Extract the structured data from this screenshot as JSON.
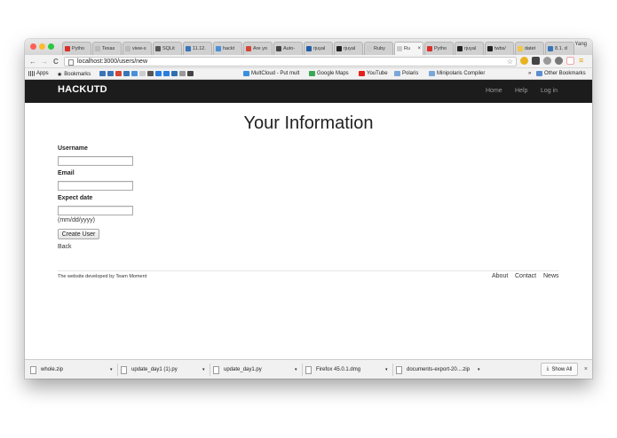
{
  "browser": {
    "profile_name": "Yang",
    "tabs": [
      {
        "label": "Pytho",
        "color": "#d9302b"
      },
      {
        "label": "Texas",
        "color": "#bbbbbb"
      },
      {
        "label": "view-s",
        "color": "#bbbbbb"
      },
      {
        "label": "SQLit",
        "color": "#555555"
      },
      {
        "label": "11.12.",
        "color": "#3a74b8"
      },
      {
        "label": "hackt",
        "color": "#4a90d9"
      },
      {
        "label": "Are yo",
        "color": "#d44638"
      },
      {
        "label": "Auto-",
        "color": "#444444"
      },
      {
        "label": "rjuyal",
        "color": "#1f5fa8"
      },
      {
        "label": "rjuyal",
        "color": "#222222"
      },
      {
        "label": "Ruby",
        "color": "#cccccc"
      },
      {
        "label": "Ru",
        "color": "#cccccc",
        "active": true
      },
      {
        "label": "Pytho",
        "color": "#d9302b"
      },
      {
        "label": "rjuyal",
        "color": "#222222"
      },
      {
        "label": "twbs/",
        "color": "#222222"
      },
      {
        "label": "datet",
        "color": "#f3c74a"
      },
      {
        "label": "8.1. d",
        "color": "#3a74b8"
      }
    ],
    "tab_close_glyph": "×",
    "url": "localhost:3000/users/new",
    "back_glyph": "←",
    "forward_glyph": "→",
    "reload_glyph": "C",
    "star_glyph": "☆",
    "menu_glyph": "≡",
    "bookmarks": {
      "apps_label": "Apps",
      "bookmarks_label": "Bookmarks",
      "items": [
        {
          "label": "MultCloud - Put mult",
          "color": "#3b8fe0"
        },
        {
          "label": "Google Maps",
          "color": "#3aa757"
        },
        {
          "label": "YouTube",
          "color": "#e62117"
        },
        {
          "label": "Polaris",
          "color": "#7aa7d9"
        },
        {
          "label": "Minipolaris Compiler",
          "color": "#7aa7d9"
        }
      ],
      "overflow_label": "»",
      "other_label": "Other Bookmarks"
    }
  },
  "site": {
    "brand": "HACKUTD",
    "nav": {
      "home": "Home",
      "help": "Help",
      "login": "Log in"
    }
  },
  "form": {
    "title": "Your Information",
    "username_label": "Username",
    "username_value": "",
    "email_label": "Email",
    "email_value": "",
    "expect_date_label": "Expect date",
    "expect_date_value": "",
    "date_hint": "(mm/dd/yyyy)",
    "submit_label": "Create User",
    "back_link": "Back"
  },
  "footer": {
    "credit_prefix": "The website developed by",
    "credit_author": "Team Moment",
    "links": {
      "about": "About",
      "contact": "Contact",
      "news": "News"
    }
  },
  "downloads": {
    "items": [
      {
        "filename": "whole.zip"
      },
      {
        "filename": "update_day1 (1).py"
      },
      {
        "filename": "update_day1.py"
      },
      {
        "filename": "Firefox 45.0.1.dmg"
      },
      {
        "filename": "documents-export-20....zip"
      }
    ],
    "caret_glyph": "▾",
    "show_all_label": "Show All",
    "close_glyph": "×"
  },
  "colors": {
    "header_bg": "#1c1c1c",
    "brand_text": "#ffffff",
    "page_bg": "#ffffff"
  }
}
